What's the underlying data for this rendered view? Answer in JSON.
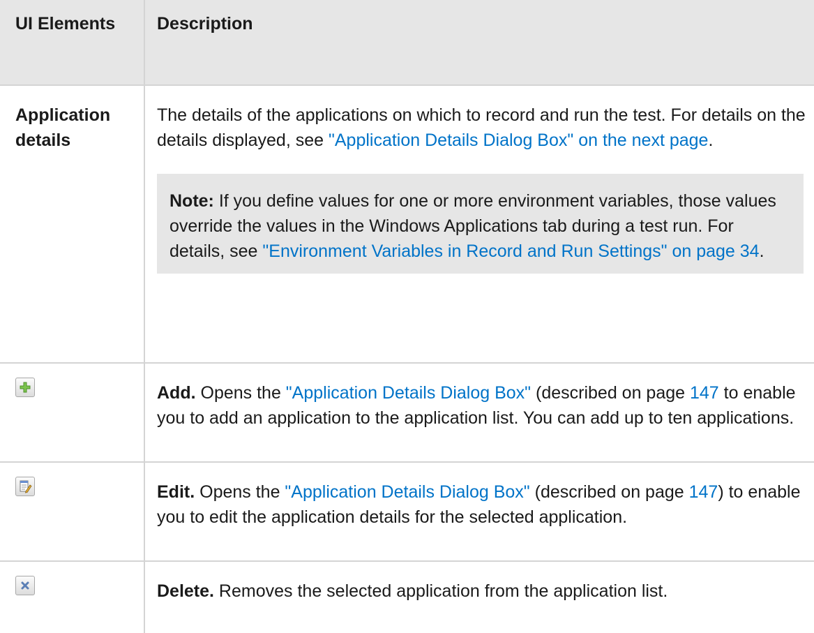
{
  "header": {
    "col_ui": "UI Elements",
    "col_description": "Description"
  },
  "rows": {
    "application_details": {
      "label": "Application details",
      "text_1": "The details of the applications on which to record and run the test. For details on the details displayed, see ",
      "link_1": "\"Application Details Dialog Box\" on the next page",
      "text_2": ".",
      "note": {
        "label": "Note:",
        "text_1": " If you define values for one or more environment variables, those values override the values in the Windows Applications tab during a test run. For details, see ",
        "link": "\"Environment Variables in Record and Run Settings\" on page 34",
        "text_2": "."
      }
    },
    "add": {
      "icon": "add-icon",
      "label": "Add.",
      "text_1": " Opens the ",
      "link_1": "\"Application Details Dialog Box\"",
      "text_2": " (described on page ",
      "link_2": "147",
      "text_3": " to enable you to add an application to the application list. You can add up to ten applications."
    },
    "edit": {
      "icon": "edit-icon",
      "label": "Edit.",
      "text_1": " Opens the ",
      "link_1": "\"Application Details Dialog Box\"",
      "text_2": " (described on page ",
      "link_2": "147",
      "text_3": ") to enable you to edit the application details for the selected application."
    },
    "delete": {
      "icon": "delete-icon",
      "label": "Delete.",
      "text_1": " Removes the selected application from the application list."
    }
  },
  "colors": {
    "header_bg": "#e6e6e6",
    "note_bg": "#e6e6e6",
    "border": "#d4d4d4",
    "link": "#0073c8",
    "text": "#1a1a1a"
  }
}
